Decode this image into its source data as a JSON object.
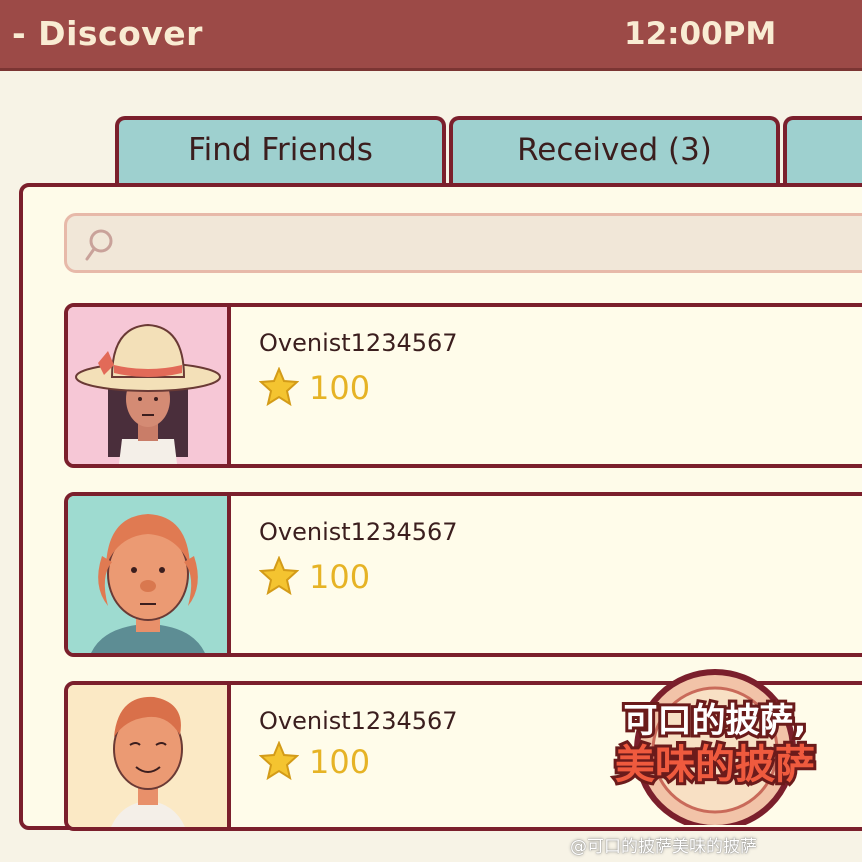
{
  "header": {
    "title": "- Discover",
    "time": "12:00PM"
  },
  "tabs": [
    {
      "label": "Find Friends"
    },
    {
      "label": "Received (3)"
    },
    {
      "label": ""
    }
  ],
  "search": {
    "placeholder": ""
  },
  "friends": [
    {
      "name": "Ovenist1234567",
      "score": "100",
      "avatar_bg": "#f6c7d6"
    },
    {
      "name": "Ovenist1234567",
      "score": "100",
      "avatar_bg": "#9edbd0"
    },
    {
      "name": "Ovenist1234567",
      "score": "100",
      "avatar_bg": "#fbe9c5"
    }
  ],
  "overlay": {
    "logo_line1": "可口的披萨,",
    "logo_line2": "美味的披萨",
    "watermark": "@可口的披萨美味的披萨"
  },
  "colors": {
    "header": "#9c4a47",
    "border": "#7b1f2c",
    "tab": "#9ed0cf",
    "score": "#e6b325"
  }
}
